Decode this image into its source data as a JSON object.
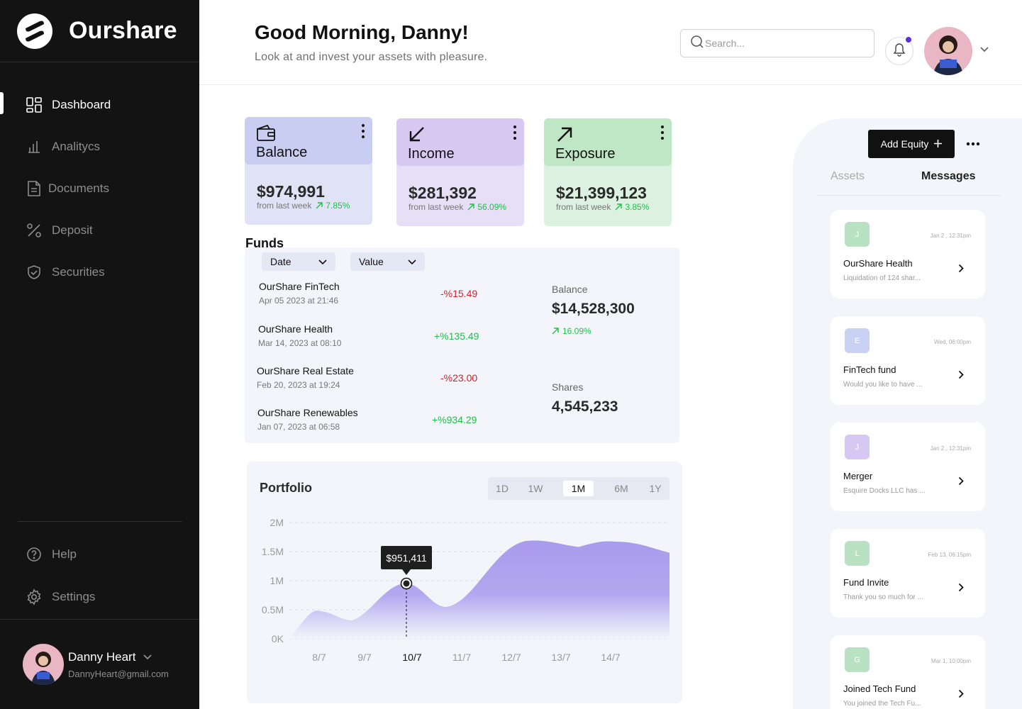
{
  "brand": {
    "name": "Ourshare"
  },
  "nav": {
    "items": [
      {
        "label": "Dashboard",
        "icon": "dashboard-icon",
        "active": true
      },
      {
        "label": "Analitycs",
        "icon": "analytics-icon"
      },
      {
        "label": "Documents",
        "icon": "document-icon"
      },
      {
        "label": "Deposit",
        "icon": "percent-icon"
      },
      {
        "label": "Securities",
        "icon": "shield-icon"
      }
    ],
    "bottom": [
      {
        "label": "Help",
        "icon": "help-icon"
      },
      {
        "label": "Settings",
        "icon": "gear-icon"
      }
    ]
  },
  "user": {
    "name": "Danny Heart",
    "email": "DannyHeart@gmail.com"
  },
  "header": {
    "greeting": "Good Morning, Danny!",
    "subtitle": "Look at and invest your assets with pleasure.",
    "search_placeholder": "Search..."
  },
  "cards": [
    {
      "title": "Balance",
      "value": "$974,991",
      "foot": "from last week",
      "pct": "7.85%"
    },
    {
      "title": "Income",
      "value": "$281,392",
      "foot": "from last week",
      "pct": "56.09%"
    },
    {
      "title": "Exposure",
      "value": "$21,399,123",
      "foot": "from last week",
      "pct": "3.85%"
    }
  ],
  "funds": {
    "title": "Funds",
    "filters": [
      "Date",
      "Value"
    ],
    "rows": [
      {
        "name": "OurShare FinTech",
        "date": "Apr 05 2023 at 21:46",
        "change": "-%15.49",
        "trend": "neg"
      },
      {
        "name": "OurShare Health",
        "date": "Mar 14, 2023 at 08:10",
        "change": "+%135.49",
        "trend": "pos"
      },
      {
        "name": "OurShare Real Estate",
        "date": "Feb 20, 2023 at 19:24",
        "change": "-%23.00",
        "trend": "neg"
      },
      {
        "name": "OurShare Renewables",
        "date": "Jan 07, 2023 at 06:58",
        "change": "+%934.29",
        "trend": "pos"
      }
    ],
    "balance_label": "Balance",
    "balance_value": "$14,528,300",
    "balance_pct": "16.09%",
    "shares_label": "Shares",
    "shares_value": "4,545,233"
  },
  "portfolio": {
    "title": "Portfolio",
    "ranges": [
      "1D",
      "1W",
      "1M",
      "6M",
      "1Y"
    ],
    "selected_range": "1M",
    "tooltip": "$951,411",
    "y_ticks": [
      "2M",
      "1.5M",
      "1M",
      "0.5M",
      "0K"
    ],
    "x_ticks": [
      "8/7",
      "9/7",
      "10/7",
      "11/7",
      "12/7",
      "13/7",
      "14/7"
    ],
    "highlight_x": "10/7",
    "accent": "#a99bec"
  },
  "chart_data": {
    "type": "area",
    "x": [
      "8/7",
      "9/7",
      "10/7",
      "11/7",
      "12/7",
      "13/7",
      "14/7"
    ],
    "values": [
      480000,
      320000,
      951411,
      550000,
      1680000,
      1580000,
      1670000
    ],
    "ylim": [
      0,
      2000000
    ],
    "y_tick_labels": [
      "0K",
      "0.5M",
      "1M",
      "1.5M",
      "2M"
    ],
    "highlight": {
      "x": "10/7",
      "label": "$951,411"
    },
    "grid": true
  },
  "right_panel": {
    "add_button": "Add Equity",
    "tabs": [
      "Assets",
      "Messages"
    ],
    "active_tab": "Messages",
    "messages": [
      {
        "initial": "J",
        "time": "Jan 2 , 12:31pm",
        "title": "OurShare Health",
        "preview": "Liquidation of 124 shar...",
        "color": "#b9e2c2"
      },
      {
        "initial": "E",
        "time": "Wed, 06:00pm",
        "title": "FinTech fund",
        "preview": "Would you like to have ...",
        "color": "#c9d1f4"
      },
      {
        "initial": "J",
        "time": "Jan 2 , 12:31pm",
        "title": "Merger",
        "preview": "Esquire Docks LLC has ...",
        "color": "#d6c8f3"
      },
      {
        "initial": "L",
        "time": "Feb 13, 06:15pm",
        "title": "Fund Invite",
        "preview": "Thank you so much for ...",
        "color": "#b9e2c2"
      },
      {
        "initial": "G",
        "time": "Mar 1, 10:00pm",
        "title": "Joined Tech Fund",
        "preview": "You joined the Tech Fu...",
        "color": "#b9e2c2"
      }
    ]
  }
}
